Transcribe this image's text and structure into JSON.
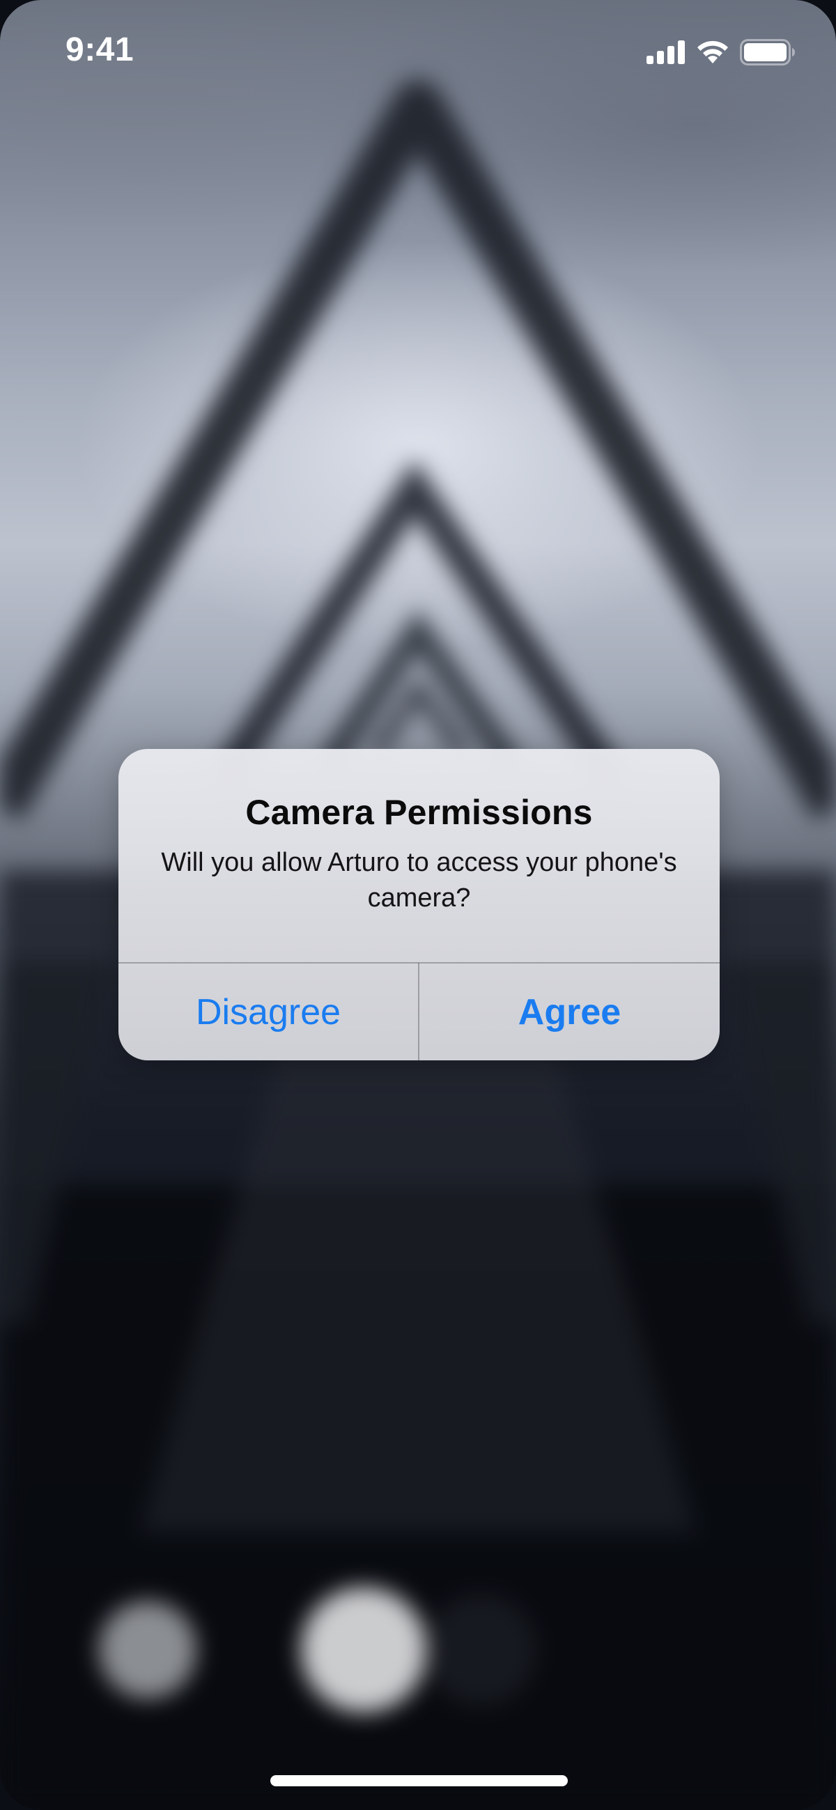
{
  "status_bar": {
    "time": "9:41",
    "icons": [
      "cellular-signal-icon",
      "wifi-icon",
      "battery-icon"
    ]
  },
  "alert": {
    "title": "Camera Permissions",
    "message": "Will you allow Arturo to access your phone's camera?",
    "buttons": {
      "disagree": "Disagree",
      "agree": "Agree"
    }
  },
  "colors": {
    "accent": "#1a7cf0",
    "alert_bg": "#e4e5ea",
    "text": "#0b0b0c"
  }
}
